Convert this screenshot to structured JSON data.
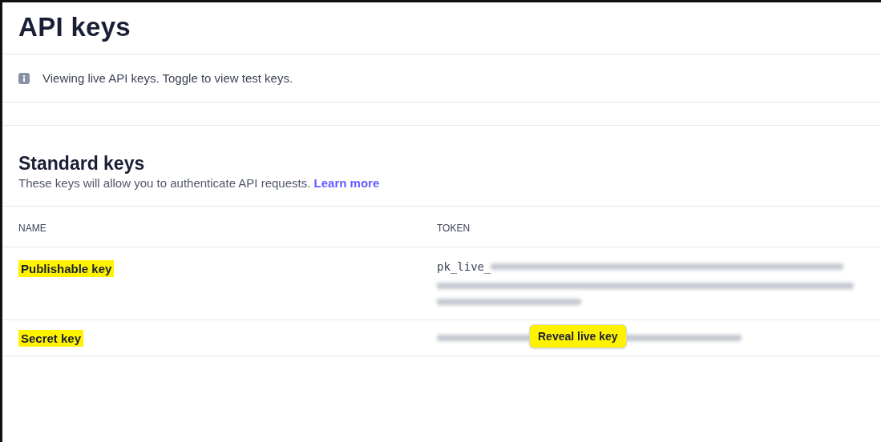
{
  "title": "API keys",
  "notice": {
    "text": "Viewing live API keys. Toggle to view test keys."
  },
  "section": {
    "title": "Standard keys",
    "description": "These keys will allow you to authenticate API requests.",
    "link": "Learn more"
  },
  "table": {
    "columns": [
      "NAME",
      "TOKEN"
    ],
    "rows": [
      {
        "name": "Publishable key",
        "highlighted": true,
        "kind": "visible",
        "token_prefix": "pk_live_"
      },
      {
        "name": "Secret key",
        "highlighted": true,
        "kind": "hidden",
        "button": {
          "label": "Reveal live key",
          "highlighted": true
        }
      }
    ]
  }
}
